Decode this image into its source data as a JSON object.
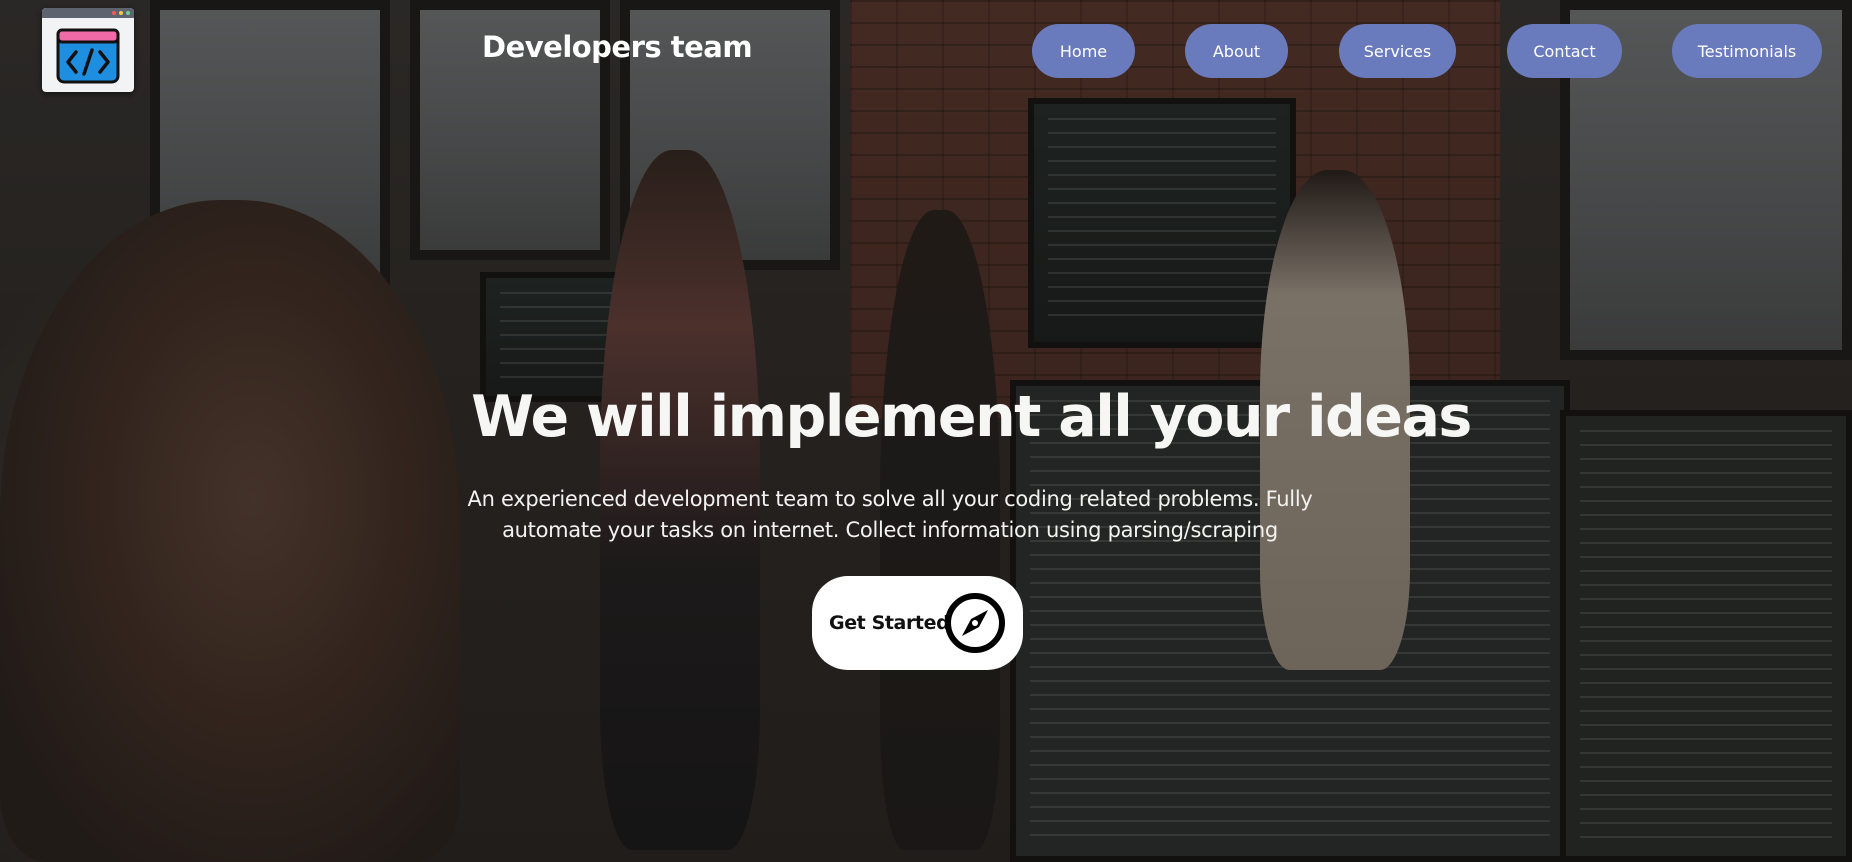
{
  "header": {
    "logo_icon": "code-window-icon",
    "brand": "Developers team",
    "nav": [
      {
        "label": "Home"
      },
      {
        "label": "About"
      },
      {
        "label": "Services"
      },
      {
        "label": "Contact"
      },
      {
        "label": "Testimonials"
      }
    ]
  },
  "hero": {
    "headline": "We will implement all your ideas",
    "subtitle_line1": "An experienced development team to solve all your coding related problems. Fully",
    "subtitle_line2": "automate your tasks on internet. Collect information using parsing/scraping",
    "cta_label": "Get Started",
    "cta_icon": "compass-icon",
    "background_image": "developers-office-photo"
  },
  "colors": {
    "nav_button": "#6a7bbd",
    "text": "#ffffff",
    "cta_background": "#ffffff"
  }
}
